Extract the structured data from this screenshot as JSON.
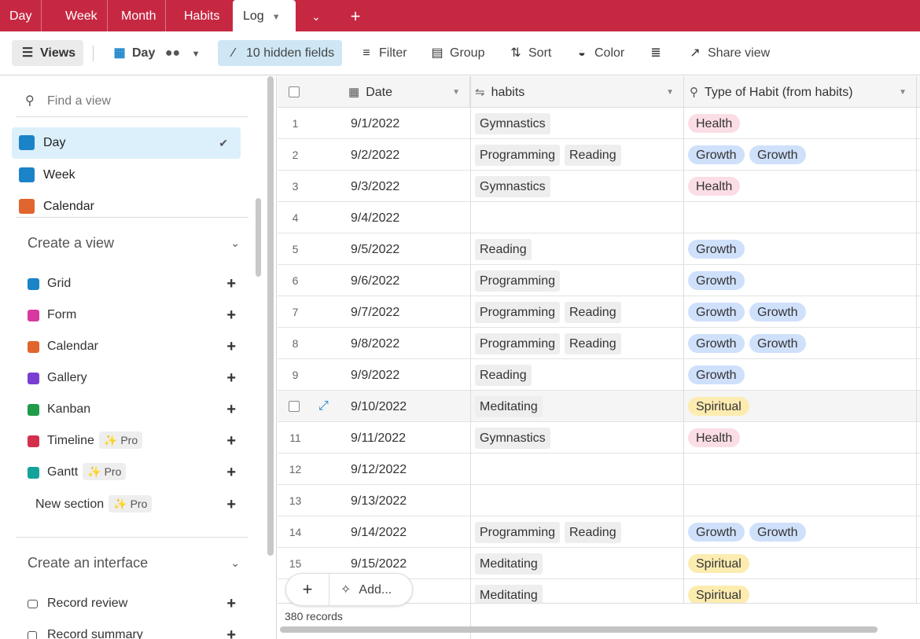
{
  "tabs": [
    {
      "label": "Day",
      "active": false
    },
    {
      "label": "Week",
      "active": false
    },
    {
      "label": "Month",
      "active": false
    },
    {
      "label": "Habits",
      "active": false
    },
    {
      "label": "Log",
      "active": true
    }
  ],
  "toolbar": {
    "views": "Views",
    "current_view": "Day",
    "hidden_fields": "10 hidden fields",
    "filter": "Filter",
    "group": "Group",
    "sort": "Sort",
    "color": "Color",
    "share_view": "Share view"
  },
  "sidebar": {
    "find_placeholder": "Find a view",
    "views": [
      {
        "label": "Day",
        "icon": "grid-icon",
        "color": "#1b83c8",
        "selected": true
      },
      {
        "label": "Week",
        "icon": "grid-icon",
        "color": "#1b83c8",
        "selected": false
      },
      {
        "label": "Calendar",
        "icon": "calendar-icon",
        "color": "#e0652f",
        "selected": false
      }
    ],
    "create_view_heading": "Create a view",
    "create_items": [
      {
        "label": "Grid",
        "color": "#1b83c8",
        "pro": false
      },
      {
        "label": "Form",
        "color": "#d63aa0",
        "pro": false
      },
      {
        "label": "Calendar",
        "color": "#e0652f",
        "pro": false
      },
      {
        "label": "Gallery",
        "color": "#7a3fd0",
        "pro": false
      },
      {
        "label": "Kanban",
        "color": "#1f9b4a",
        "pro": false
      },
      {
        "label": "Timeline",
        "color": "#d4304e",
        "pro": true
      },
      {
        "label": "Gantt",
        "color": "#14a39a",
        "pro": true
      }
    ],
    "new_section": "New section",
    "pro_label": "Pro",
    "create_interface_heading": "Create an interface",
    "interface_items": [
      {
        "label": "Record review"
      },
      {
        "label": "Record summary"
      }
    ]
  },
  "grid": {
    "columns": [
      "Date",
      "habits",
      "Type of Habit (from habits)"
    ],
    "rows": [
      {
        "num": "1",
        "date": "9/1/2022",
        "habits": [
          "Gymnastics"
        ],
        "types": [
          "Health"
        ]
      },
      {
        "num": "2",
        "date": "9/2/2022",
        "habits": [
          "Programming",
          "Reading"
        ],
        "types": [
          "Growth",
          "Growth"
        ]
      },
      {
        "num": "3",
        "date": "9/3/2022",
        "habits": [
          "Gymnastics"
        ],
        "types": [
          "Health"
        ]
      },
      {
        "num": "4",
        "date": "9/4/2022",
        "habits": [],
        "types": []
      },
      {
        "num": "5",
        "date": "9/5/2022",
        "habits": [
          "Reading"
        ],
        "types": [
          "Growth"
        ]
      },
      {
        "num": "6",
        "date": "9/6/2022",
        "habits": [
          "Programming"
        ],
        "types": [
          "Growth"
        ]
      },
      {
        "num": "7",
        "date": "9/7/2022",
        "habits": [
          "Programming",
          "Reading"
        ],
        "types": [
          "Growth",
          "Growth"
        ]
      },
      {
        "num": "8",
        "date": "9/8/2022",
        "habits": [
          "Programming",
          "Reading"
        ],
        "types": [
          "Growth",
          "Growth"
        ]
      },
      {
        "num": "9",
        "date": "9/9/2022",
        "habits": [
          "Reading"
        ],
        "types": [
          "Growth"
        ]
      },
      {
        "num": "",
        "date": "9/10/2022",
        "habits": [
          "Meditating"
        ],
        "types": [
          "Spiritual"
        ],
        "hover": true
      },
      {
        "num": "11",
        "date": "9/11/2022",
        "habits": [
          "Gymnastics"
        ],
        "types": [
          "Health"
        ]
      },
      {
        "num": "12",
        "date": "9/12/2022",
        "habits": [],
        "types": []
      },
      {
        "num": "13",
        "date": "9/13/2022",
        "habits": [],
        "types": []
      },
      {
        "num": "14",
        "date": "9/14/2022",
        "habits": [
          "Programming",
          "Reading"
        ],
        "types": [
          "Growth",
          "Growth"
        ]
      },
      {
        "num": "15",
        "date": "9/15/2022",
        "habits": [
          "Meditating"
        ],
        "types": [
          "Spiritual"
        ]
      },
      {
        "num": "",
        "date": "",
        "habits": [
          "Meditating"
        ],
        "types": [
          "Spiritual"
        ]
      }
    ],
    "type_colors": {
      "Health": "#fbdde5",
      "Growth": "#cfe0fb",
      "Spiritual": "#fcecb0"
    },
    "records": "380 records",
    "add_label": "Add..."
  }
}
